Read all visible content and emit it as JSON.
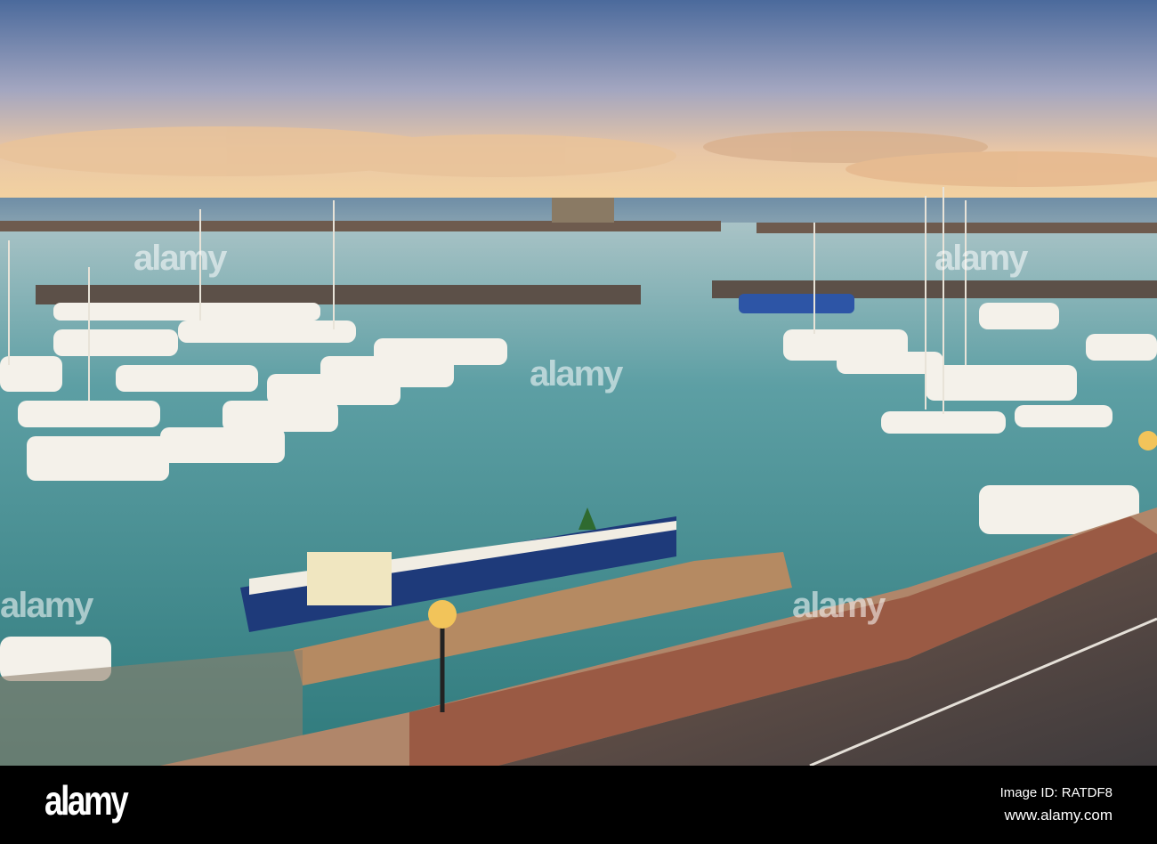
{
  "watermark": {
    "text": "alamy",
    "repeat_text": "alamy"
  },
  "footer": {
    "logo": "alamy",
    "image_id": "Image ID: RATDF8",
    "website": "www.alamy.com"
  },
  "colors": {
    "sky_top": "#4f6f9e",
    "sky_glow": "#f2c98a",
    "water": "#3f8f8c",
    "promenade": "#5a4a44"
  }
}
